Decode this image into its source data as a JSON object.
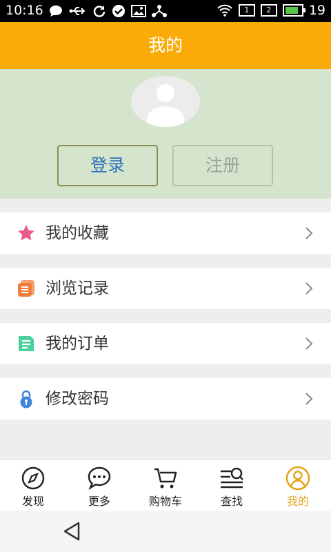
{
  "status_bar": {
    "time": "10:16",
    "sim1": "1",
    "sim2": "2",
    "battery_level": "19"
  },
  "header": {
    "title": "我的"
  },
  "profile": {
    "login_label": "登录",
    "register_label": "注册"
  },
  "menu": [
    {
      "label": "我的收藏",
      "icon": "star-icon",
      "color": "#e95b8f"
    },
    {
      "label": "浏览记录",
      "icon": "history-icon",
      "color": "#f07f3b"
    },
    {
      "label": "我的订单",
      "icon": "order-icon",
      "color": "#49d19a"
    },
    {
      "label": "修改密码",
      "icon": "lock-icon",
      "color": "#3d86d8"
    }
  ],
  "tabs": [
    {
      "label": "发现",
      "icon": "compass-icon"
    },
    {
      "label": "更多",
      "icon": "chat-bubble-icon"
    },
    {
      "label": "购物车",
      "icon": "cart-icon"
    },
    {
      "label": "查找",
      "icon": "search-list-icon"
    },
    {
      "label": "我的",
      "icon": "user-icon",
      "active": true
    }
  ],
  "colors": {
    "brand": "#fbab08",
    "profile_bg": "#d5e5cd",
    "active_tab": "#e3a31c"
  }
}
